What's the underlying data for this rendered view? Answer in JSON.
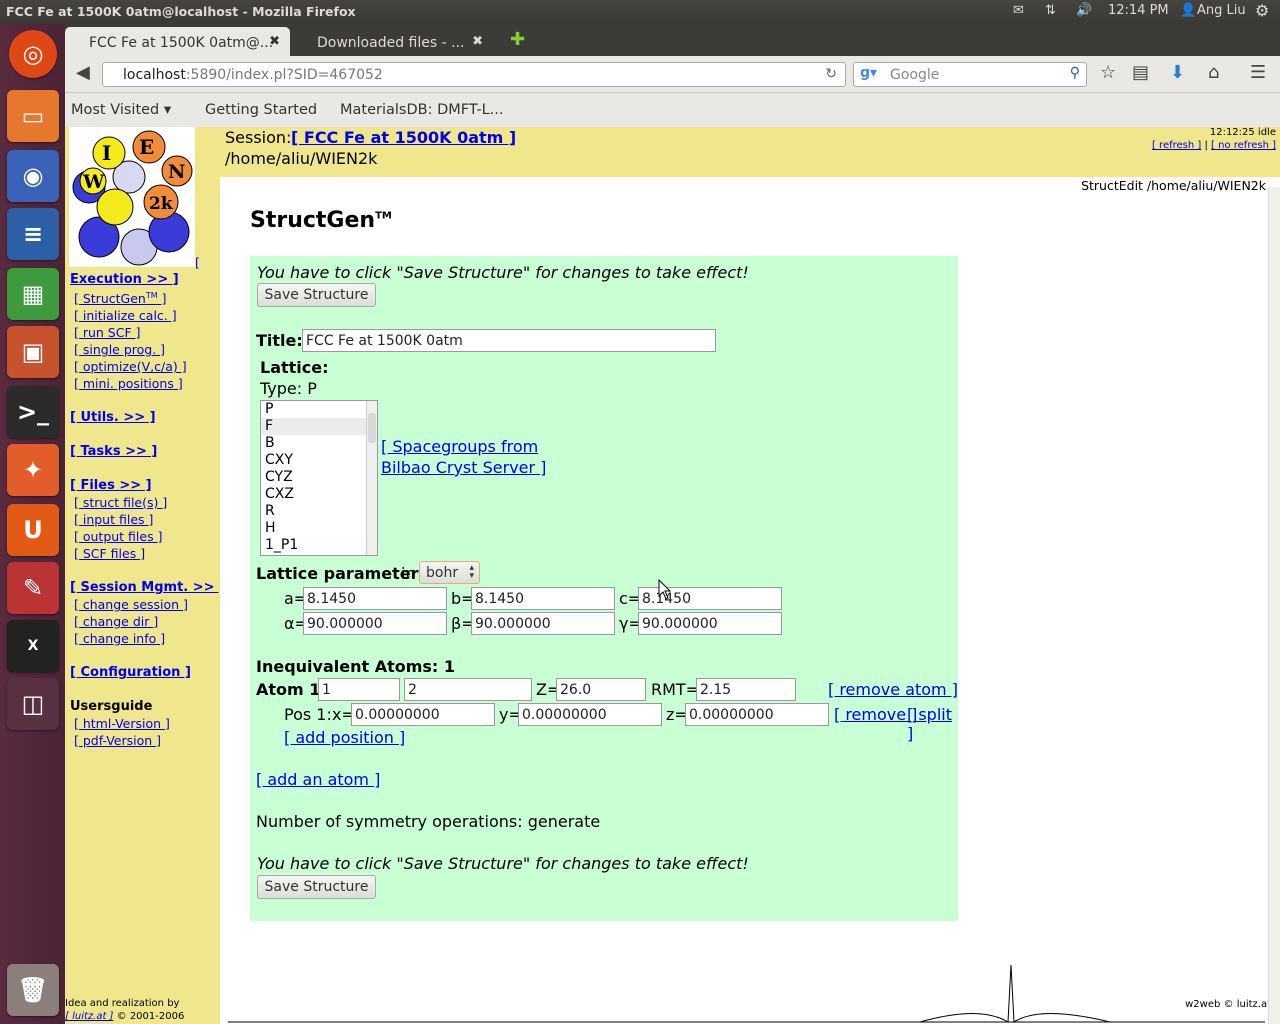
{
  "system": {
    "window_title": "FCC Fe at 1500K 0atm@localhost - Mozilla Firefox",
    "clock": "12:14 PM",
    "user": "Ang Liu"
  },
  "browser": {
    "tabs": [
      {
        "label": "FCC Fe at 1500K 0atm@...",
        "close": "✖"
      },
      {
        "label": "Downloaded files - ...",
        "close": "✖"
      }
    ],
    "new_tab": "✚",
    "url_host": "localhost",
    "url_rest": ":5890/index.pl?SID=467052",
    "search_placeholder": "Google",
    "bookmarks": [
      "Most Visited ▾",
      "Getting Started",
      "MaterialsDB: DMFT-L..."
    ]
  },
  "session": {
    "label": "Session:",
    "name": "[ FCC Fe at 1500K 0atm ]",
    "dir": "/home/aliu/WIEN2k",
    "time": "12:12:25 idle",
    "refresh": "[ refresh ]",
    "sep": "|",
    "no_refresh": "[ no refresh ]",
    "page_path": "StructEdit /home/aliu/WIEN2k"
  },
  "sidebar": {
    "logo_bracket": "[",
    "execution": "Execution >> ]",
    "exec_items": [
      "[ StructGen",
      "[ initialize calc. ]",
      "[ run SCF ]",
      "[ single prog. ]",
      "[ optimize(V,c/a) ]",
      "[ mini. positions ]"
    ],
    "structgen_tm": "TM",
    "structgen_close": " ]",
    "utils": "[ Utils. >> ]",
    "tasks": "[ Tasks >> ]",
    "files": "[ Files >> ]",
    "file_items": [
      "[ struct file(s) ]",
      "[ input files ]",
      "[ output files ]",
      "[ SCF files ]"
    ],
    "session_mgmt": "[ Session Mgmt. >> ]",
    "session_items": [
      "[ change session ]",
      "[ change dir ]",
      "[ change info ]"
    ],
    "configuration": "[ Configuration ]",
    "usersguide": "Usersguide",
    "guide_items": [
      "[ html-Version ]",
      "[ pdf-Version ]"
    ],
    "credit1": "Idea and realization by",
    "credit_link": "[ luitz.at ]",
    "credit2": "© 2001-2006"
  },
  "main": {
    "heading": "StructGen",
    "heading_tm": "TM",
    "notice": "You have to click \"Save Structure\" for changes to take effect!",
    "save_label": "Save Structure",
    "title_label": "Title:",
    "title_value": "FCC Fe at 1500K 0atm",
    "lattice_label": "Lattice:",
    "type_label": "Type: P",
    "lattice_options": [
      "P",
      "F",
      "B",
      "CXY",
      "CYZ",
      "CXZ",
      "R",
      "H",
      "1_P1"
    ],
    "selected_option": "F",
    "spacegroups_link_1": "[ Spacegroups from",
    "spacegroups_link_2": "Bilbao Cryst Server ]",
    "lattice_params_label": "Lattice parameters",
    "in_label": "in",
    "unit_value": "bohr",
    "a_label": "a=",
    "a": "8.1450",
    "b_label": "b=",
    "b": "8.1450",
    "c_label": "c=",
    "c": "8.1450",
    "alpha_label": "α=",
    "alpha": "90.000000",
    "beta_label": "β=",
    "beta": "90.000000",
    "gamma_label": "γ=",
    "gamma": "90.000000",
    "inequiv_label": "Inequivalent Atoms: 1",
    "atom_label": "Atom 1:",
    "atom_name": "1",
    "atom_field2": "2",
    "z_label": "Z=",
    "z": "26.0",
    "rmt_label": "RMT=",
    "rmt": "2.15",
    "remove_atom": "[ remove atom ]",
    "pos_label": "Pos 1:",
    "x_label": "x=",
    "x": "0.00000000",
    "y_label": "y=",
    "y": "0.00000000",
    "zpos_label": "z=",
    "zpos": "0.00000000",
    "remove": "[ remove ]",
    "split": "[ split ]",
    "add_position": "[ add position ]",
    "add_atom": "[ add an atom ]",
    "symmetry": "Number of symmetry operations: generate",
    "footer": "w2web © luitz.at"
  }
}
